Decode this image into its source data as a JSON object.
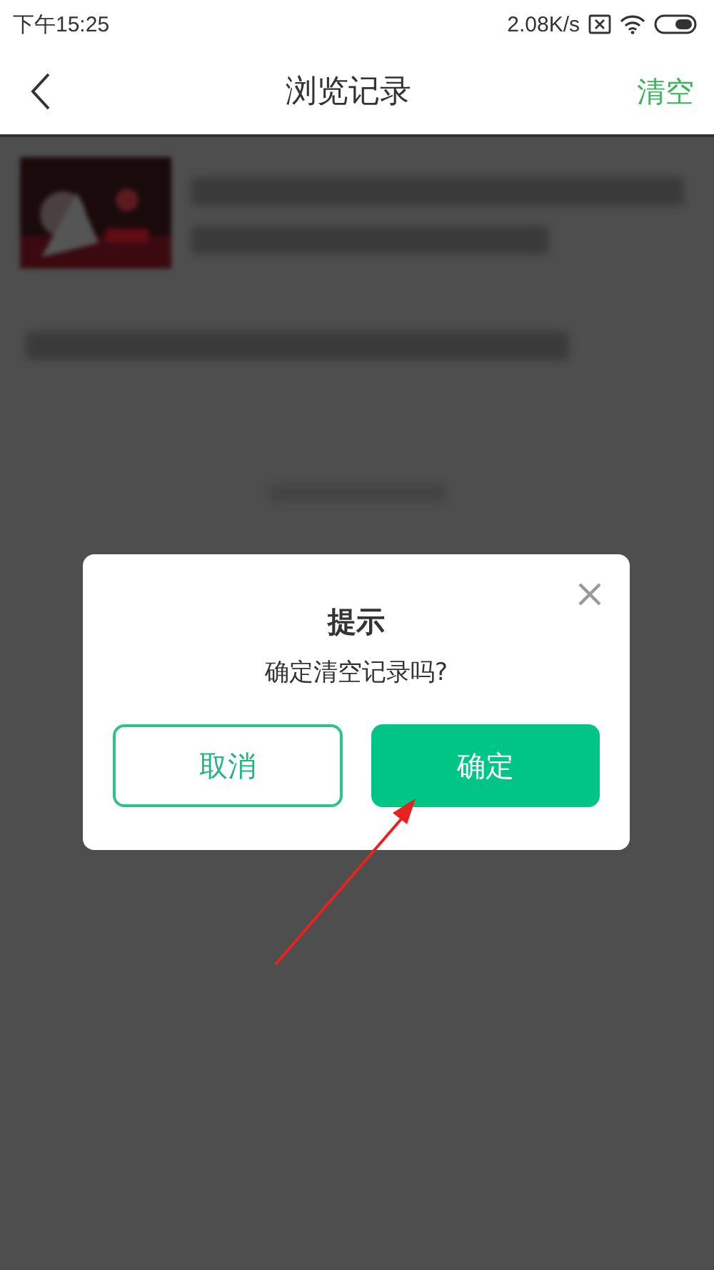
{
  "status_bar": {
    "time": "下午15:25",
    "speed": "2.08K/s"
  },
  "header": {
    "title": "浏览记录",
    "action": "清空"
  },
  "background_list": {
    "kind": "blurred"
  },
  "dialog": {
    "title": "提示",
    "message": "确定清空记录吗?",
    "buttons": [
      {
        "label": "取消",
        "kind": "outline"
      },
      {
        "label": "确定",
        "kind": "filled"
      }
    ]
  },
  "annotation": {
    "kind": "arrow",
    "color": "#e8231f"
  }
}
